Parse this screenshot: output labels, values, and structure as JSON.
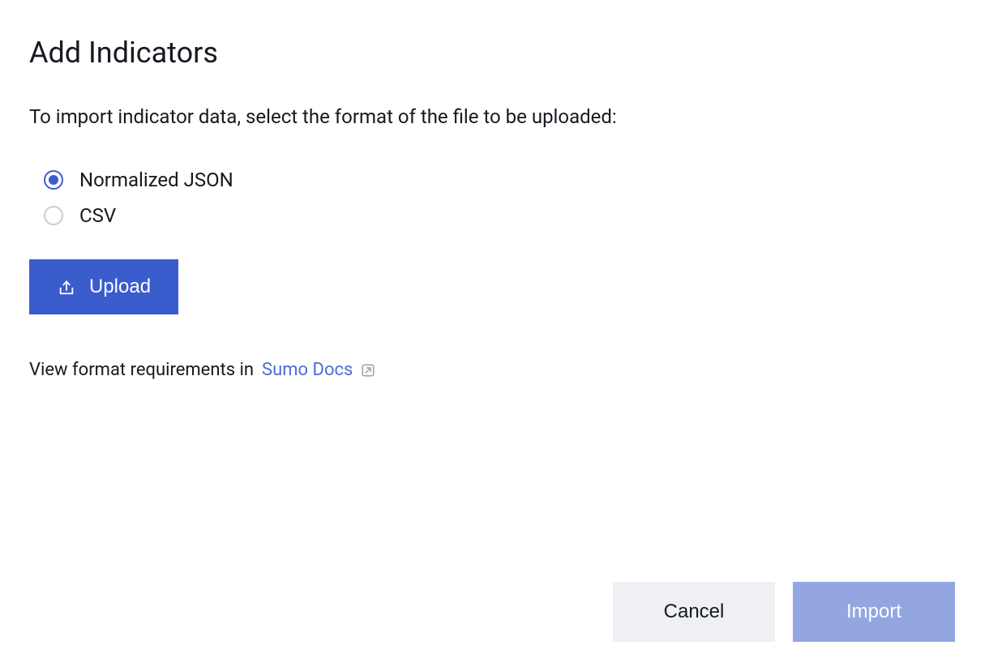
{
  "header": {
    "title": "Add Indicators"
  },
  "description": "To import indicator data, select the format of the file to be uploaded:",
  "formatOptions": {
    "json": {
      "label": "Normalized JSON",
      "selected": true
    },
    "csv": {
      "label": "CSV",
      "selected": false
    }
  },
  "upload": {
    "label": "Upload"
  },
  "docs": {
    "prefix": "View format requirements in",
    "link_label": "Sumo Docs"
  },
  "footer": {
    "cancel_label": "Cancel",
    "import_label": "Import"
  }
}
